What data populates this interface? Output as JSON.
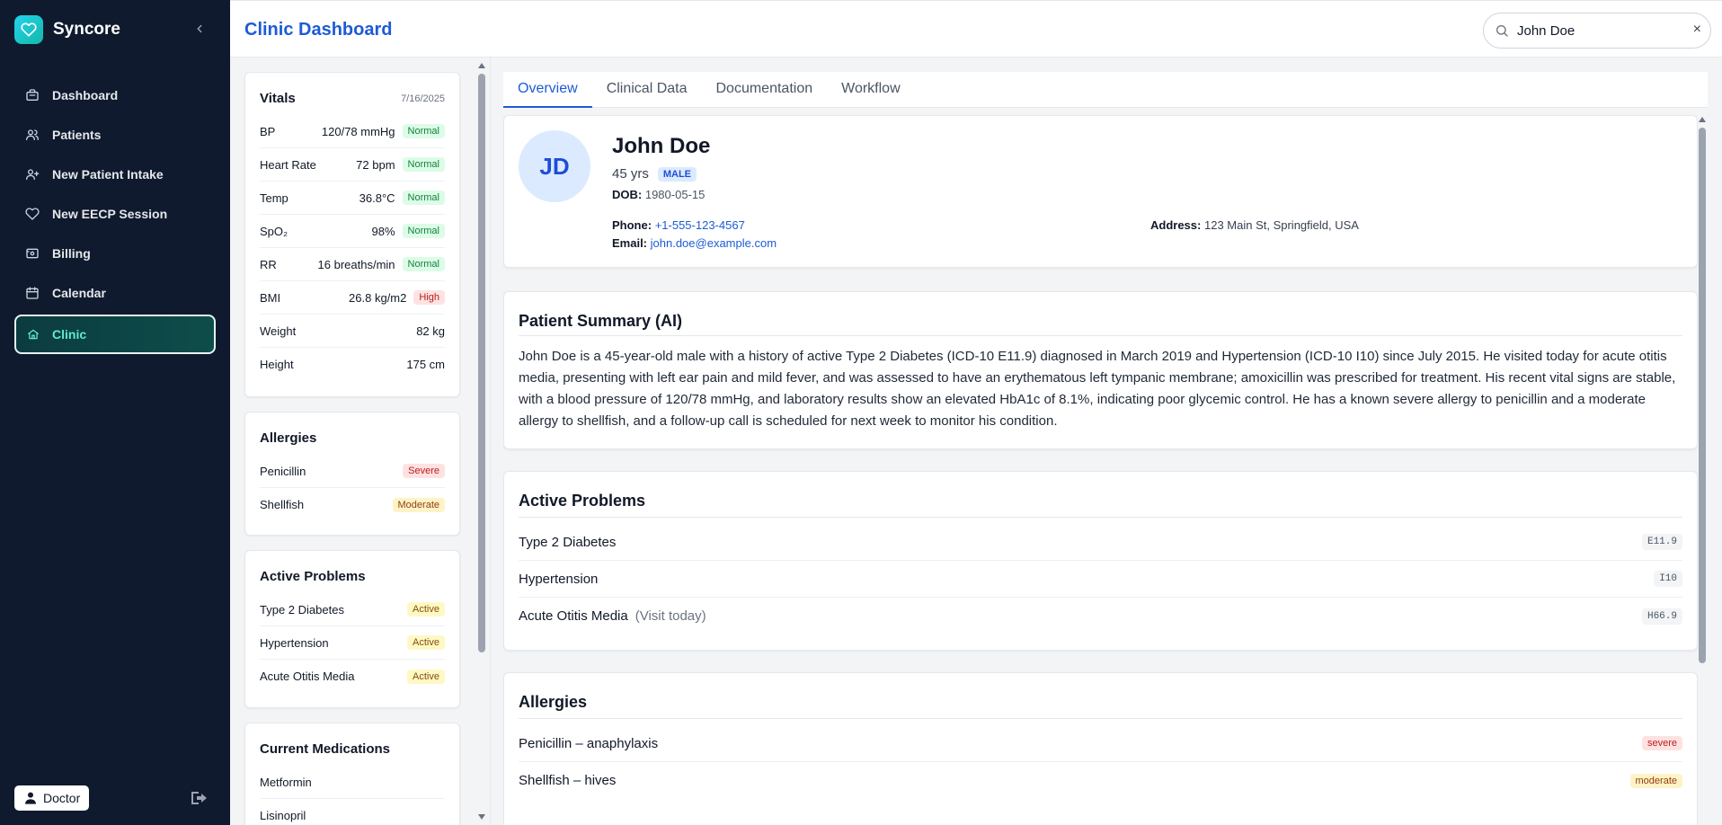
{
  "app": {
    "name": "Syncore"
  },
  "sidebar": {
    "items": [
      {
        "label": "Dashboard",
        "icon": "briefcase-icon"
      },
      {
        "label": "Patients",
        "icon": "users-icon"
      },
      {
        "label": "New Patient Intake",
        "icon": "user-plus-icon"
      },
      {
        "label": "New EECP Session",
        "icon": "heart-icon"
      },
      {
        "label": "Billing",
        "icon": "receipt-icon"
      },
      {
        "label": "Calendar",
        "icon": "calendar-icon"
      },
      {
        "label": "Clinic",
        "icon": "home-icon",
        "active": true
      }
    ],
    "role_label": "Doctor"
  },
  "header": {
    "title": "Clinic Dashboard"
  },
  "search": {
    "value": "John Doe",
    "clear_glyph": "×"
  },
  "vitals": {
    "title": "Vitals",
    "date": "7/16/2025",
    "rows": [
      {
        "label": "BP",
        "value": "120/78 mmHg",
        "status": "Normal"
      },
      {
        "label": "Heart Rate",
        "value": "72 bpm",
        "status": "Normal"
      },
      {
        "label": "Temp",
        "value": "36.8°C",
        "status": "Normal"
      },
      {
        "label": "SpO₂",
        "value": "98%",
        "status": "Normal"
      },
      {
        "label": "RR",
        "value": "16 breaths/min",
        "status": "Normal"
      },
      {
        "label": "BMI",
        "value": "26.8 kg/m2",
        "status": "High"
      },
      {
        "label": "Weight",
        "value": "82 kg"
      },
      {
        "label": "Height",
        "value": "175 cm"
      }
    ]
  },
  "left_allergies": {
    "title": "Allergies",
    "rows": [
      {
        "label": "Penicillin",
        "severity": "Severe"
      },
      {
        "label": "Shellfish",
        "severity": "Moderate"
      }
    ]
  },
  "left_problems": {
    "title": "Active Problems",
    "rows": [
      {
        "label": "Type 2 Diabetes",
        "status": "Active"
      },
      {
        "label": "Hypertension",
        "status": "Active"
      },
      {
        "label": "Acute Otitis Media",
        "status": "Active"
      }
    ]
  },
  "left_meds": {
    "title": "Current Medications",
    "rows": [
      "Metformin",
      "Lisinopril"
    ]
  },
  "tabs": [
    "Overview",
    "Clinical Data",
    "Documentation",
    "Workflow"
  ],
  "patient": {
    "initials": "JD",
    "name": "John Doe",
    "age": "45 yrs",
    "sex": "MALE",
    "dob_label": "DOB:",
    "dob": "1980-05-15",
    "phone_label": "Phone:",
    "phone": "+1-555-123-4567",
    "email_label": "Email:",
    "email": "john.doe@example.com",
    "address_label": "Address:",
    "address": "123 Main St, Springfield, USA"
  },
  "summary": {
    "title": "Patient Summary (AI)",
    "text": "John Doe is a 45-year-old male with a history of active Type 2 Diabetes (ICD-10 E11.9) diagnosed in March 2019 and Hypertension (ICD-10 I10) since July 2015. He visited today for acute otitis media, presenting with left ear pain and mild fever, and was assessed to have an erythematous left tympanic membrane; amoxicillin was prescribed for treatment. His recent vital signs are stable, with a blood pressure of 120/78 mmHg, and laboratory results show an elevated HbA1c of 8.1%, indicating poor glycemic control. He has a known severe allergy to penicillin and a moderate allergy to shellfish, and a follow-up call is scheduled for next week to monitor his condition."
  },
  "problems": {
    "title": "Active Problems",
    "rows": [
      {
        "label": "Type 2 Diabetes",
        "code": "E11.9",
        "note": ""
      },
      {
        "label": "Hypertension",
        "code": "I10",
        "note": ""
      },
      {
        "label": "Acute Otitis Media",
        "code": "H66.9",
        "note": "(Visit today)"
      }
    ]
  },
  "allergies": {
    "title": "Allergies",
    "rows": [
      {
        "label": "Penicillin – anaphylaxis",
        "severity": "severe"
      },
      {
        "label": "Shellfish – hives",
        "severity": "moderate"
      }
    ]
  },
  "colors": {
    "sidebar_bg": "#0f1a2e",
    "accent_blue": "#1d5bd6",
    "accent_teal": "#5eead4",
    "normal_green": "#15803d",
    "danger_red": "#b91c1c",
    "warning_amber": "#92400e"
  }
}
